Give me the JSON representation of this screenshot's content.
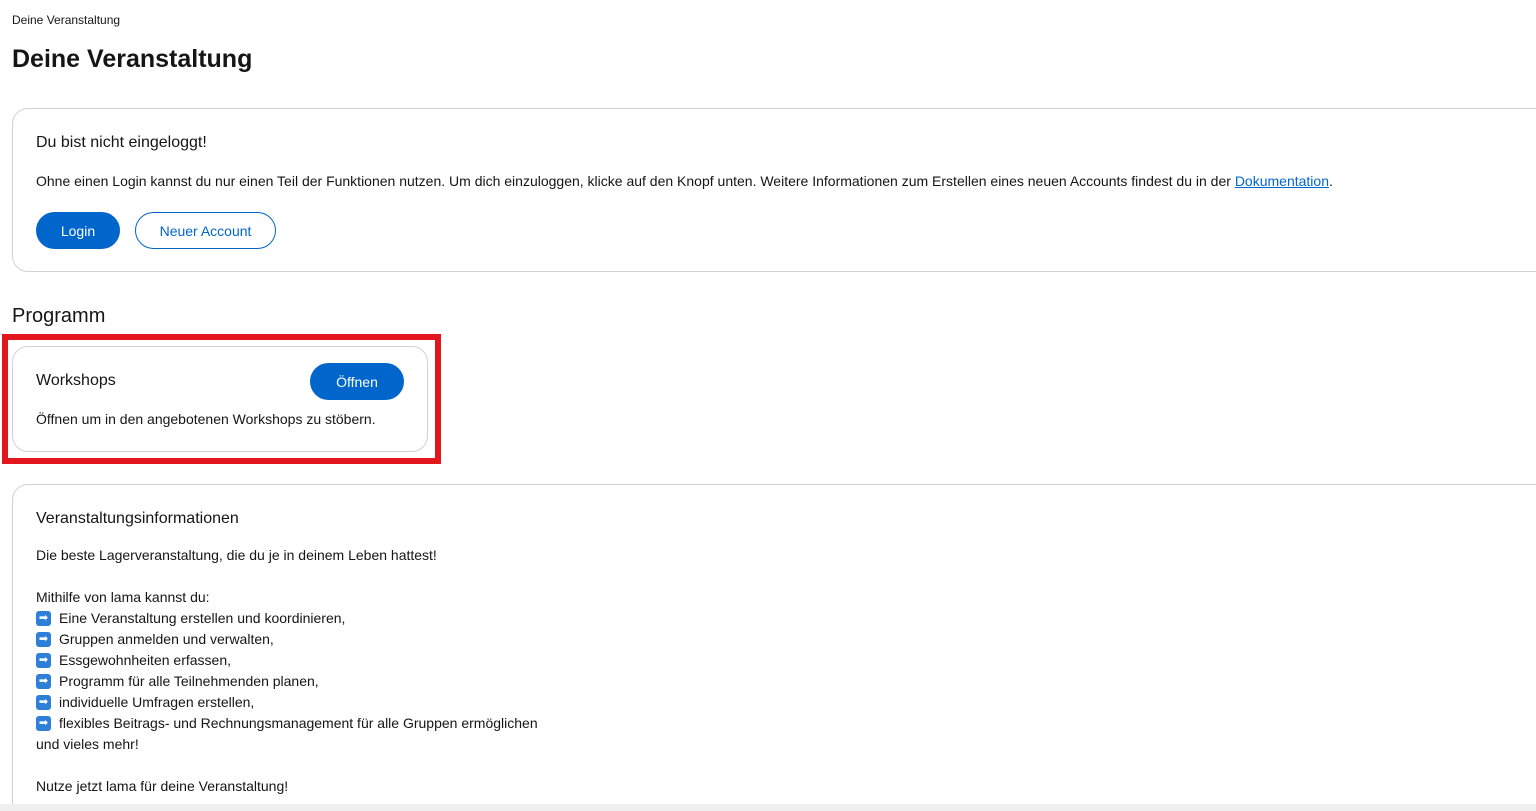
{
  "breadcrumb": "Deine Veranstaltung",
  "page_title": "Deine Veranstaltung",
  "login_card": {
    "title": "Du bist nicht eingeloggt!",
    "text_before_link": "Ohne einen Login kannst du nur einen Teil der Funktionen nutzen. Um dich einzuloggen, klicke auf den Knopf unten. Weitere Informationen zum Erstellen eines neuen Accounts findest du in der ",
    "link_text": "Dokumentation",
    "text_after_link": ".",
    "login_label": "Login",
    "new_account_label": "Neuer Account"
  },
  "program": {
    "heading": "Programm",
    "workshops": {
      "title": "Workshops",
      "open_label": "Öffnen",
      "text": "Öffnen um in den angebotenen Workshops zu stöbern."
    }
  },
  "info": {
    "title": "Veranstaltungsinformationen",
    "intro": "Die beste Lagerveranstaltung, die du je in deinem Leben hattest!",
    "lead": "Mithilfe von lama kannst du:",
    "features": [
      "Eine Veranstaltung erstellen und koordinieren,",
      "Gruppen anmelden und verwalten,",
      "Essgewohnheiten erfassen,",
      "Programm für alle Teilnehmenden planen,",
      "individuelle Umfragen erstellen,",
      "flexibles Beitrags- und Rechnungsmanagement für alle Gruppen ermöglichen"
    ],
    "more": "und vieles mehr!",
    "cta": "Nutze jetzt lama für deine Veranstaltung!"
  },
  "colors": {
    "primary": "#0066cc",
    "highlight": "#e3161d",
    "arrow_icon": "#2e7fd8"
  },
  "icons": {
    "feature_bullet": "right-arrow-icon"
  }
}
